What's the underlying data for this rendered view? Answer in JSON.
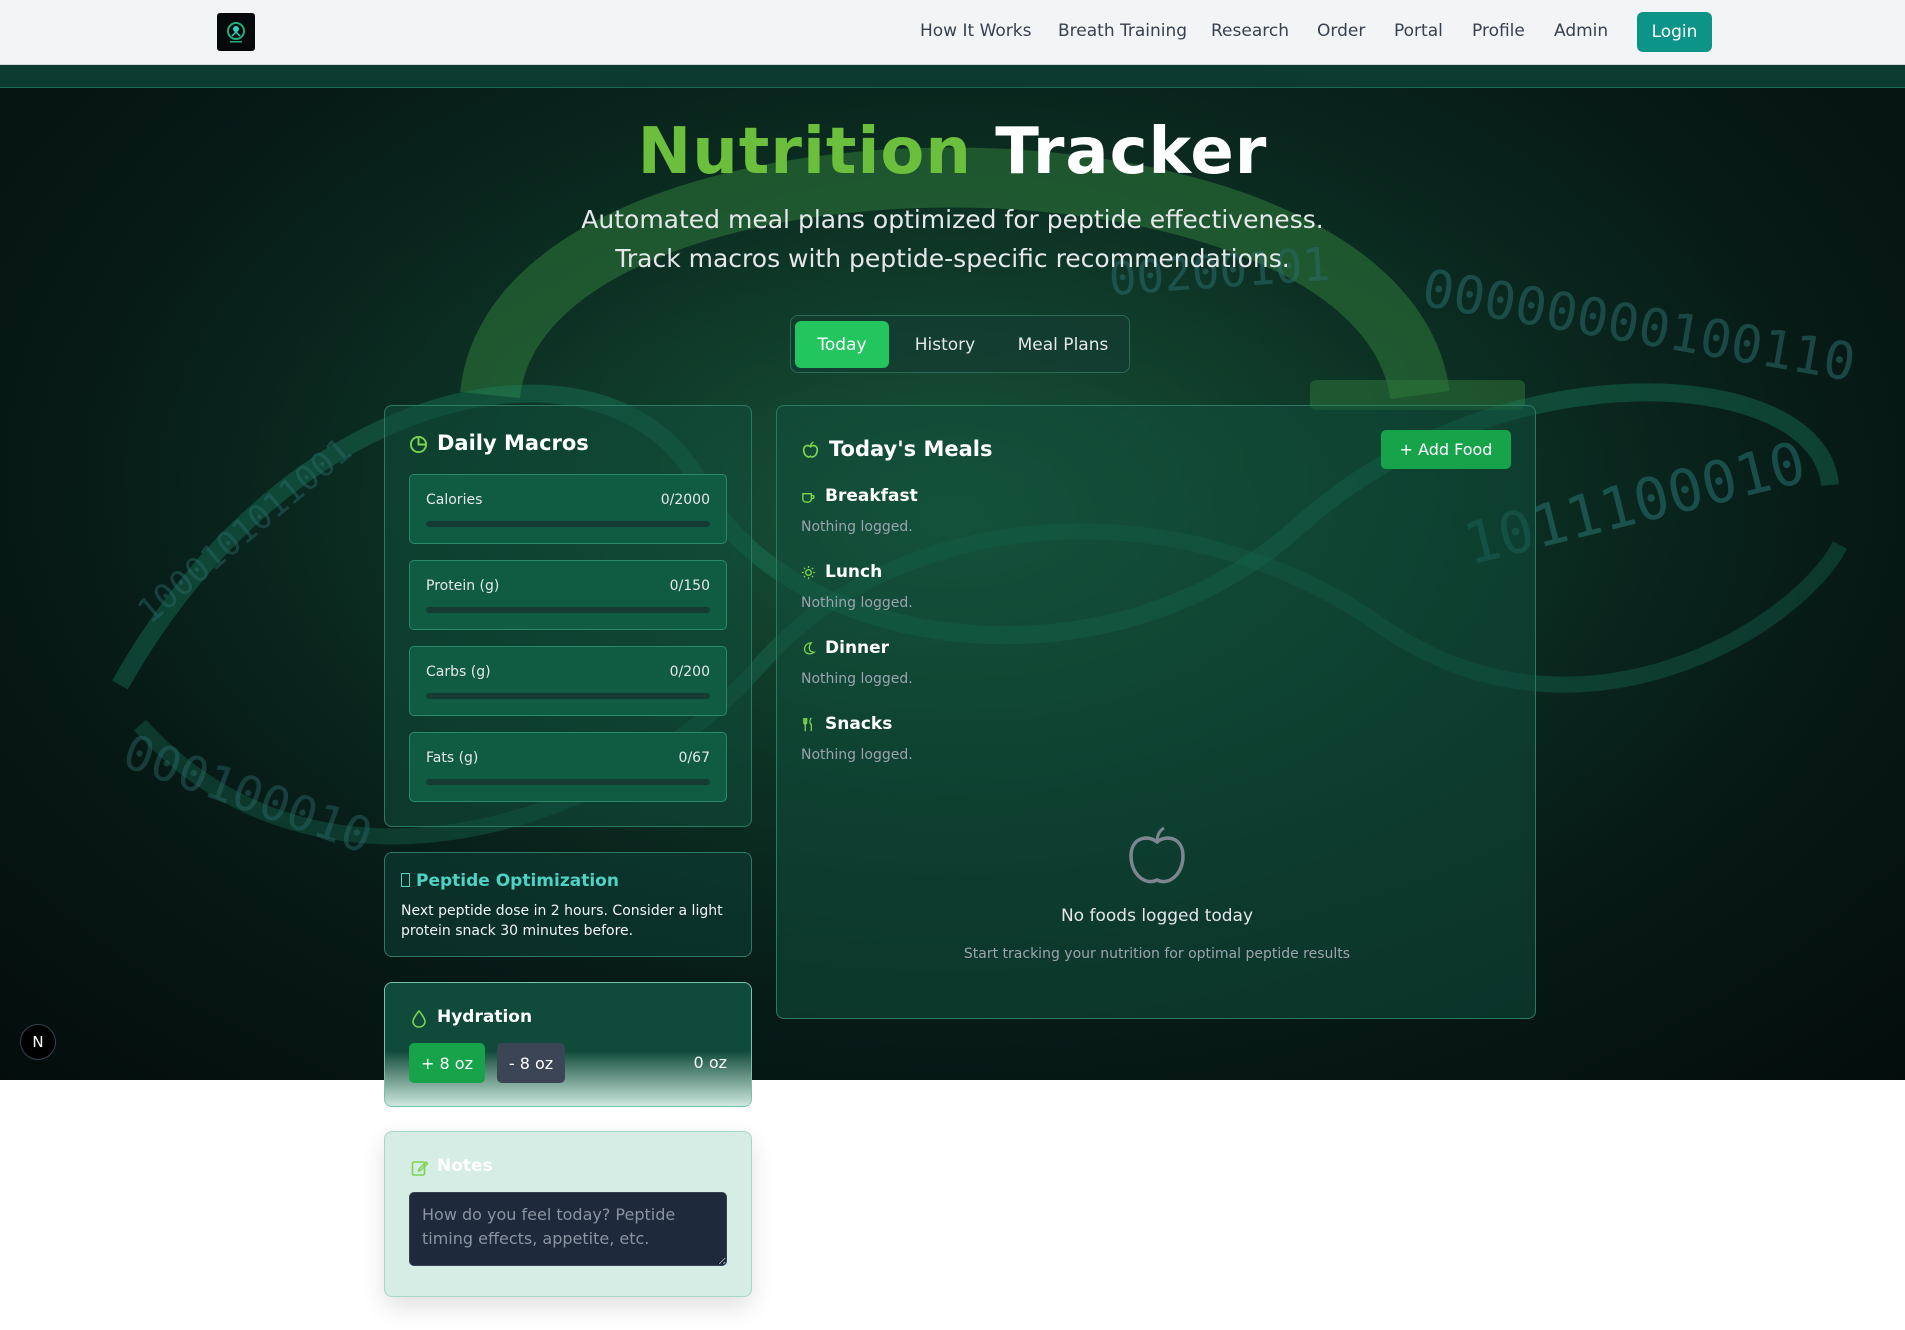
{
  "header": {
    "nav": [
      "How It Works",
      "Breath Training",
      "Research",
      "Order",
      "Portal",
      "Profile",
      "Admin"
    ],
    "login_label": "Login"
  },
  "hero": {
    "title_part1": "Nutrition",
    "title_part2": "Tracker",
    "subtitle_line1": "Automated meal plans optimized for peptide effectiveness.",
    "subtitle_line2": "Track macros with peptide-specific recommendations."
  },
  "tabs": [
    {
      "label": "Today",
      "active": true
    },
    {
      "label": "History",
      "active": false
    },
    {
      "label": "Meal Plans",
      "active": false
    }
  ],
  "macros": {
    "title": "Daily Macros",
    "items": [
      {
        "label": "Calories",
        "value": "0/2000",
        "progress": 0
      },
      {
        "label": "Protein (g)",
        "value": "0/150",
        "progress": 0
      },
      {
        "label": "Carbs (g)",
        "value": "0/200",
        "progress": 0
      },
      {
        "label": "Fats (g)",
        "value": "0/67",
        "progress": 0
      }
    ]
  },
  "peptide": {
    "title": "Peptide Optimization",
    "text": "Next peptide dose in 2 hours. Consider a light protein snack 30 minutes before."
  },
  "hydration": {
    "title": "Hydration",
    "add_label": "+ 8 oz",
    "remove_label": "- 8 oz",
    "amount": "0 oz"
  },
  "notes": {
    "title": "Notes",
    "placeholder": "How do you feel today? Peptide timing effects, appetite, etc."
  },
  "meals": {
    "title": "Today's Meals",
    "add_label": "+  Add Food",
    "sections": [
      {
        "name": "Breakfast",
        "empty": "Nothing logged."
      },
      {
        "name": "Lunch",
        "empty": "Nothing logged."
      },
      {
        "name": "Dinner",
        "empty": "Nothing logged."
      },
      {
        "name": "Snacks",
        "empty": "Nothing logged."
      }
    ],
    "empty_title": "No foods logged today",
    "empty_sub": "Start tracking your nutrition for optimal peptide results"
  },
  "badge": "N",
  "colors": {
    "accent_green": "#22c55e",
    "title_green": "#6cbf3c",
    "teal": "#0d9488",
    "peptide_teal": "#4fd1c5"
  }
}
